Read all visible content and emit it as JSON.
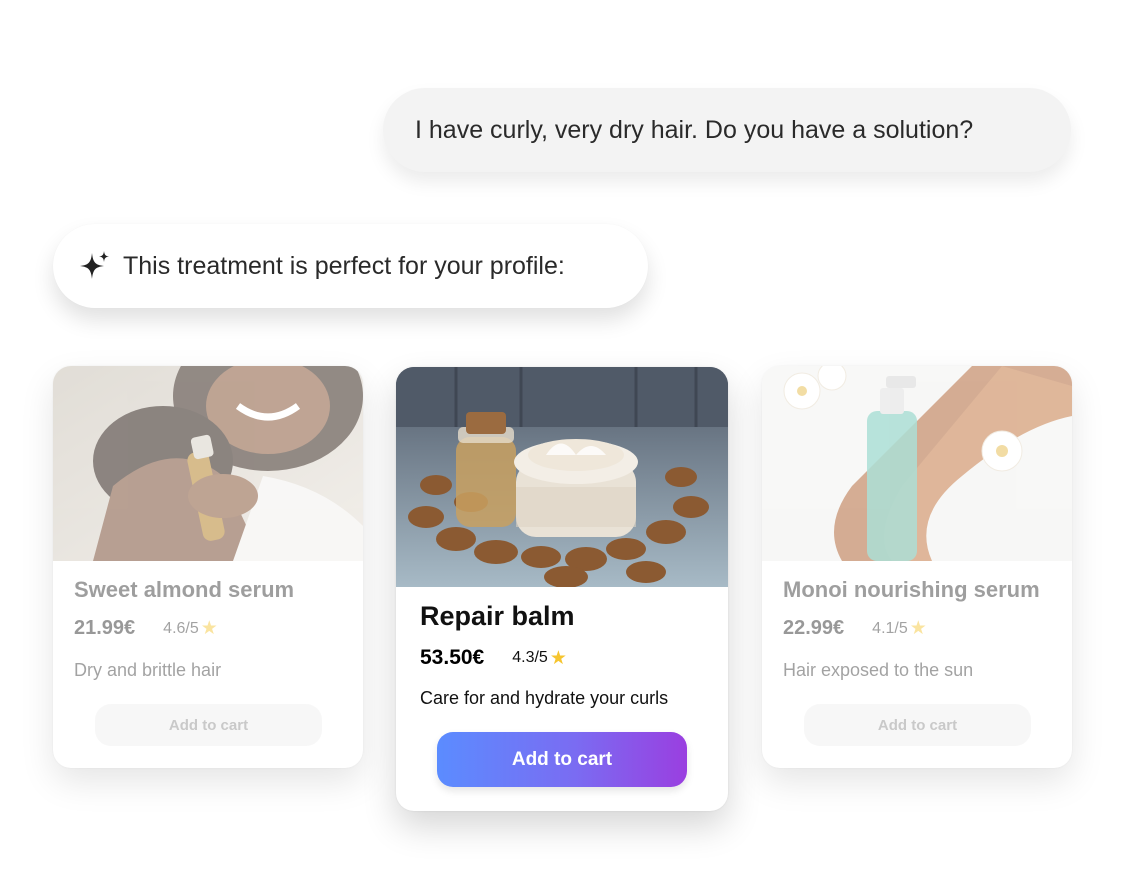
{
  "chat": {
    "user_message": "I have curly, very dry hair. Do you have a solution?",
    "bot_message": "This treatment is perfect for your profile:"
  },
  "products": [
    {
      "name": "Sweet almond serum",
      "price": "21.99€",
      "rating": "4.6/5",
      "description": "Dry and brittle hair",
      "button_label": "Add to cart",
      "highlighted": false
    },
    {
      "name": "Repair balm",
      "price": "53.50€",
      "rating": "4.3/5",
      "description": "Care for and hydrate your curls",
      "button_label": "Add to cart",
      "highlighted": true
    },
    {
      "name": "Monoi nourishing serum",
      "price": "22.99€",
      "rating": "4.1/5",
      "description": "Hair exposed to the sun",
      "button_label": "Add to cart",
      "highlighted": false
    }
  ],
  "icons": {
    "assistant": "sparkle-icon",
    "rating": "star-icon"
  },
  "colors": {
    "button_gradient_start": "#5b8cff",
    "button_gradient_end": "#9a3fe0",
    "star": "#f6c52f"
  }
}
